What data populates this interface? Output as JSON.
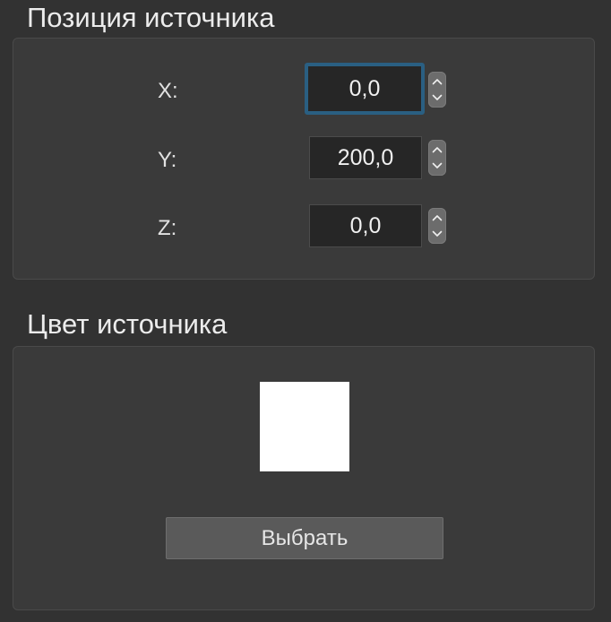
{
  "position_section": {
    "title": "Позиция источника",
    "x": {
      "label": "X:",
      "value": "0,0"
    },
    "y": {
      "label": "Y:",
      "value": "200,0"
    },
    "z": {
      "label": "Z:",
      "value": "0,0"
    }
  },
  "color_section": {
    "title": "Цвет источника",
    "swatch_color": "#ffffff",
    "choose_label": "Выбрать"
  },
  "colors": {
    "background": "#323232",
    "group_box": "#3a3a3a",
    "field": "#262626",
    "focus_ring": "#2a5f82",
    "stepper": "#6c6c6c",
    "button": "#5a5a5a"
  },
  "icons": {
    "stepper_up": "chevron-up-icon",
    "stepper_down": "chevron-down-icon"
  }
}
